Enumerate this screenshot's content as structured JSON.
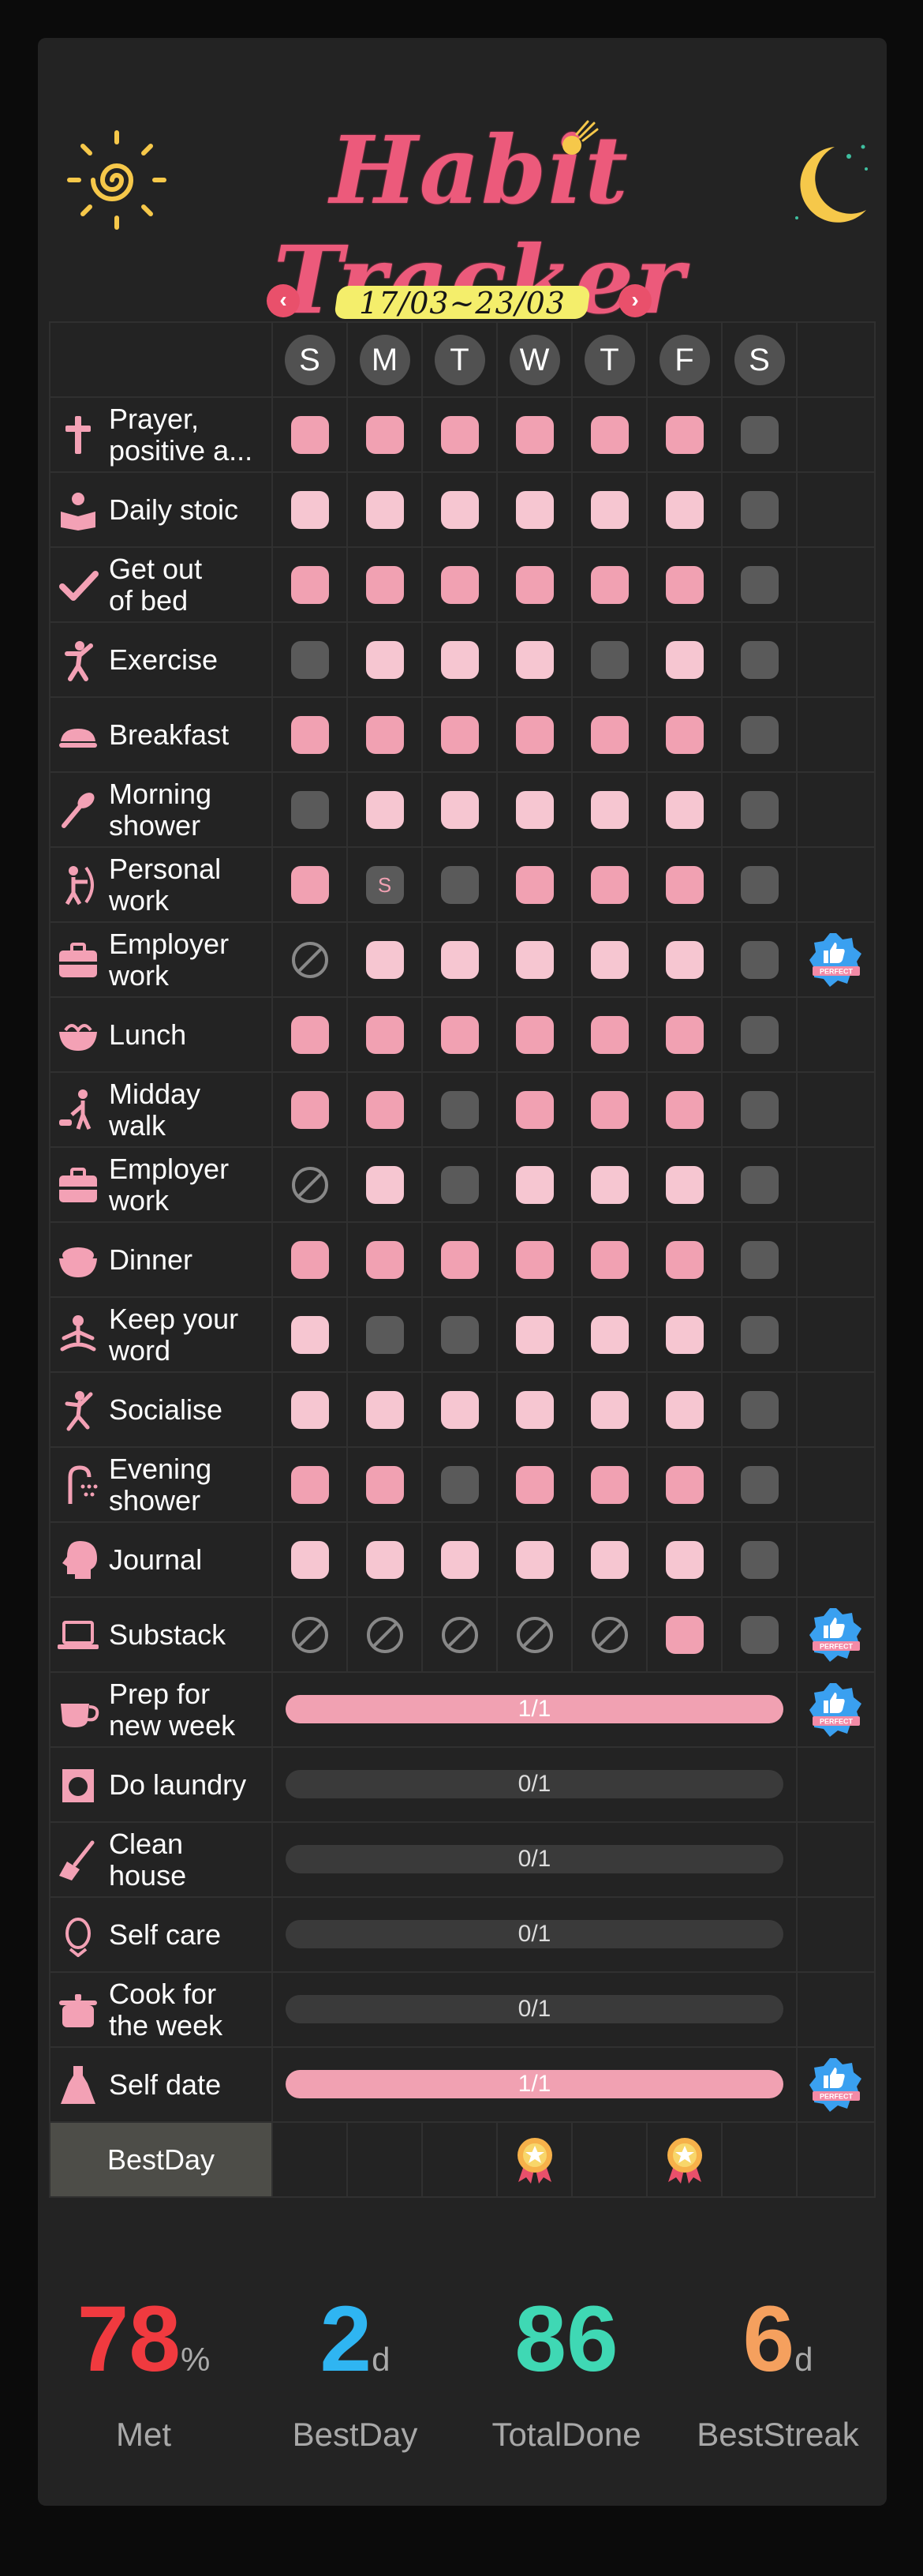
{
  "header": {
    "title": "Habit Tracker",
    "week_range": "17/03~23/03"
  },
  "days": [
    "S",
    "M",
    "T",
    "W",
    "T",
    "F",
    "S"
  ],
  "habits": [
    {
      "name": "Prayer,\npositive a...",
      "icon": "cross-icon",
      "days": [
        "p",
        "p",
        "p",
        "p",
        "p",
        "p",
        "d"
      ],
      "perfect": false
    },
    {
      "name": "Daily stoic",
      "icon": "reading-icon",
      "days": [
        "l",
        "l",
        "l",
        "l",
        "l",
        "l",
        "d"
      ],
      "perfect": false
    },
    {
      "name": "Get out\nof bed",
      "icon": "check-icon",
      "days": [
        "p",
        "p",
        "p",
        "p",
        "p",
        "p",
        "d"
      ],
      "perfect": false
    },
    {
      "name": "Exercise",
      "icon": "exercise-icon",
      "days": [
        "d",
        "l",
        "l",
        "l",
        "d",
        "l",
        "d"
      ],
      "perfect": false
    },
    {
      "name": "Breakfast",
      "icon": "bread-icon",
      "days": [
        "p",
        "p",
        "p",
        "p",
        "p",
        "p",
        "d"
      ],
      "perfect": false
    },
    {
      "name": "Morning\nshower",
      "icon": "brush-icon",
      "days": [
        "d",
        "l",
        "l",
        "l",
        "l",
        "l",
        "d"
      ],
      "perfect": false
    },
    {
      "name": "Personal\nwork",
      "icon": "archery-icon",
      "days": [
        "p",
        "s",
        "d",
        "p",
        "p",
        "p",
        "d"
      ],
      "perfect": false
    },
    {
      "name": "Employer\nwork",
      "icon": "briefcase-icon",
      "days": [
        "x",
        "l",
        "l",
        "l",
        "l",
        "l",
        "d"
      ],
      "perfect": true
    },
    {
      "name": "Lunch",
      "icon": "bowl-icon",
      "days": [
        "p",
        "p",
        "p",
        "p",
        "p",
        "p",
        "d"
      ],
      "perfect": false
    },
    {
      "name": "Midday\nwalk",
      "icon": "dog-walk-icon",
      "days": [
        "p",
        "p",
        "d",
        "p",
        "p",
        "p",
        "d"
      ],
      "perfect": false
    },
    {
      "name": "Employer\nwork",
      "icon": "briefcase-icon",
      "days": [
        "x",
        "l",
        "d",
        "l",
        "l",
        "l",
        "d"
      ],
      "perfect": false
    },
    {
      "name": "Dinner",
      "icon": "rice-bowl-icon",
      "days": [
        "p",
        "p",
        "p",
        "p",
        "p",
        "p",
        "d"
      ],
      "perfect": false
    },
    {
      "name": "Keep your\nword",
      "icon": "meditate-icon",
      "days": [
        "l",
        "d",
        "d",
        "l",
        "l",
        "l",
        "d"
      ],
      "perfect": false
    },
    {
      "name": "Socialise",
      "icon": "dance-icon",
      "days": [
        "l",
        "l",
        "l",
        "l",
        "l",
        "l",
        "d"
      ],
      "perfect": false
    },
    {
      "name": "Evening\nshower",
      "icon": "shower-icon",
      "days": [
        "p",
        "p",
        "d",
        "p",
        "p",
        "p",
        "d"
      ],
      "perfect": false
    },
    {
      "name": "Journal",
      "icon": "brain-icon",
      "days": [
        "l",
        "l",
        "l",
        "l",
        "l",
        "l",
        "d"
      ],
      "perfect": false
    },
    {
      "name": "Substack",
      "icon": "laptop-icon",
      "days": [
        "x",
        "x",
        "x",
        "x",
        "x",
        "p",
        "d"
      ],
      "perfect": true
    }
  ],
  "weekly_habits": [
    {
      "name": "Prep for\nnew week",
      "icon": "coffee-icon",
      "progress": "1/1",
      "fraction": 1,
      "perfect": true
    },
    {
      "name": "Do laundry",
      "icon": "laundry-icon",
      "progress": "0/1",
      "fraction": 0,
      "perfect": false
    },
    {
      "name": "Clean\nhouse",
      "icon": "broom-icon",
      "progress": "0/1",
      "fraction": 0,
      "perfect": false
    },
    {
      "name": "Self care",
      "icon": "face-mask-icon",
      "progress": "0/1",
      "fraction": 0,
      "perfect": false
    },
    {
      "name": "Cook for\nthe week",
      "icon": "pot-icon",
      "progress": "0/1",
      "fraction": 0,
      "perfect": false
    },
    {
      "name": "Self date",
      "icon": "dress-icon",
      "progress": "1/1",
      "fraction": 1,
      "perfect": true
    }
  ],
  "bestday": {
    "label": "BestDay",
    "medals": [
      false,
      false,
      false,
      true,
      false,
      true,
      false
    ]
  },
  "badge_text": "PERFECT",
  "stats": [
    {
      "value": "78",
      "unit": "%",
      "label": "Met",
      "color": "#f03a3f"
    },
    {
      "value": "2",
      "unit": "d",
      "label": "BestDay",
      "color": "#2fb5f2"
    },
    {
      "value": "86",
      "unit": "",
      "label": "TotalDone",
      "color": "#3fd8b4"
    },
    {
      "value": "6",
      "unit": "d",
      "label": "BestStreak",
      "color": "#f5a05e"
    }
  ],
  "colors": {
    "accent_pink": "#f1a1b2",
    "light_pink": "#f6c6d1",
    "undone": "#5a5a5a",
    "nav": "#e9506b",
    "background": "#232323"
  }
}
